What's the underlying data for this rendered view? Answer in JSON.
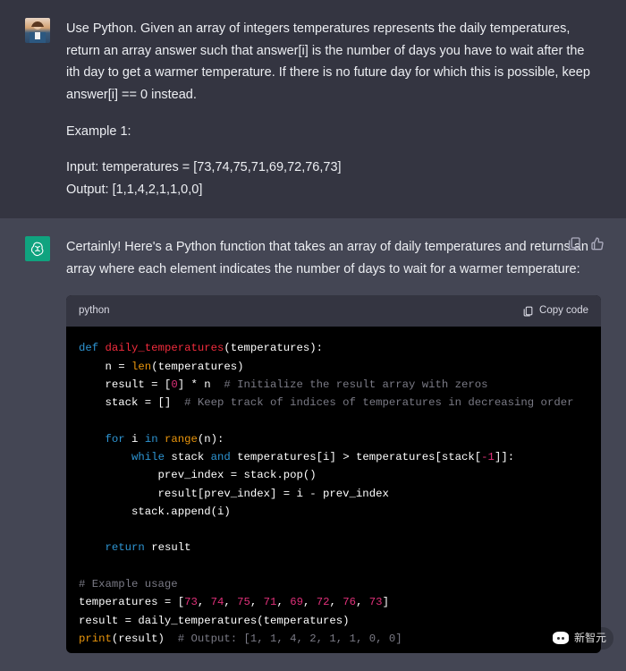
{
  "user_message": {
    "p1": "Use Python. Given an array of integers temperatures represents the daily temperatures, return an array answer such that answer[i] is the number of days you have to wait after the ith day to get a warmer temperature. If there is no future day for which this is possible, keep answer[i] == 0 instead.",
    "p2": "Example 1:",
    "p3": "Input: temperatures = [73,74,75,71,69,72,76,73]",
    "p4": "Output: [1,1,4,2,1,1,0,0]"
  },
  "ai_message": {
    "intro": "Certainly! Here's a Python function that takes an array of daily temperatures and returns an array where each element indicates the number of days to wait for a warmer temperature:",
    "lang_label": "python",
    "copy_label": "Copy code",
    "code": {
      "l1_def": "def",
      "l1_fn": "daily_temperatures",
      "l1_params": "(temperatures):",
      "l2_a": "    n = ",
      "l2_len": "len",
      "l2_b": "(temperatures)",
      "l3_a": "    result = [",
      "l3_zero": "0",
      "l3_b": "] * n  ",
      "l3_c": "# Initialize the result array with zeros",
      "l4_a": "    stack = []  ",
      "l4_c": "# Keep track of indices of temperatures in decreasing order",
      "l5": "",
      "l6_a": "    ",
      "l6_for": "for",
      "l6_b": " i ",
      "l6_in": "in",
      "l6_c": " ",
      "l6_range": "range",
      "l6_d": "(n):",
      "l7_a": "        ",
      "l7_while": "while",
      "l7_b": " stack ",
      "l7_and": "and",
      "l7_c": " temperatures[i] > temperatures[stack[",
      "l7_neg1": "-1",
      "l7_d": "]]:",
      "l8": "            prev_index = stack.pop()",
      "l9": "            result[prev_index] = i - prev_index",
      "l10": "        stack.append(i)",
      "l11": "",
      "l12_a": "    ",
      "l12_ret": "return",
      "l12_b": " result",
      "l13": "",
      "l14": "# Example usage",
      "l15_a": "temperatures = [",
      "l15_n1": "73",
      "l15_s1": ", ",
      "l15_n2": "74",
      "l15_s2": ", ",
      "l15_n3": "75",
      "l15_s3": ", ",
      "l15_n4": "71",
      "l15_s4": ", ",
      "l15_n5": "69",
      "l15_s5": ", ",
      "l15_n6": "72",
      "l15_s6": ", ",
      "l15_n7": "76",
      "l15_s7": ", ",
      "l15_n8": "73",
      "l15_b": "]",
      "l16": "result = daily_temperatures(temperatures)",
      "l17_print": "print",
      "l17_a": "(result)  ",
      "l17_c": "# Output: [1, 1, 4, 2, 1, 1, 0, 0]"
    }
  },
  "watermark": "新智元"
}
